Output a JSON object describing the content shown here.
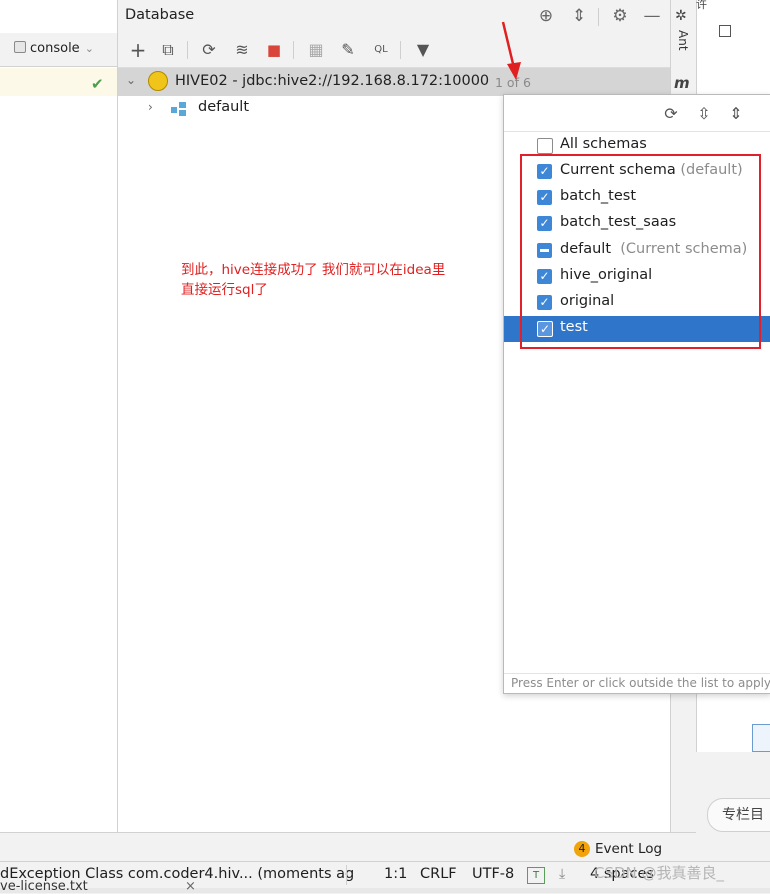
{
  "db_window": {
    "title": "Database",
    "connection": {
      "label": "HIVE02 - jdbc:hive2://192.168.8.172:10000",
      "count": "1 of 6"
    },
    "tree_child": "default"
  },
  "editor": {
    "tab_label": "console"
  },
  "side": {
    "ant_label": "Ant",
    "m_label": "m"
  },
  "popup": {
    "schemas": [
      {
        "label": "All schemas",
        "hint": "",
        "state": "unchecked"
      },
      {
        "label": "Current schema",
        "hint": "(default)",
        "state": "checked"
      },
      {
        "label": "batch_test",
        "hint": "",
        "state": "checked"
      },
      {
        "label": "batch_test_saas",
        "hint": "",
        "state": "checked"
      },
      {
        "label": "default",
        "hint": "(Current schema)",
        "state": "partial"
      },
      {
        "label": "hive_original",
        "hint": "",
        "state": "checked"
      },
      {
        "label": "original",
        "hint": "",
        "state": "checked"
      },
      {
        "label": "test",
        "hint": "",
        "state": "checked",
        "selected": true
      }
    ],
    "footer": "Press Enter or click outside the list to apply"
  },
  "annotation": {
    "line1": "到此，hive连接成功了  我们就可以在idea里",
    "line2": "直接运行sql了"
  },
  "event_log": {
    "badge": "4",
    "label": "Event Log"
  },
  "status_bar": {
    "message": "dException Class com.coder4.hiv... (moments ag",
    "position": "1:1",
    "line_sep": "CRLF",
    "encoding": "UTF-8",
    "indent": "4 spaces"
  },
  "right_panel": {
    "top_char": "许",
    "button": "专栏目"
  },
  "watermark": "CSDN @我真善良_",
  "bottom_tab": "ve-license.txt",
  "colors": {
    "accent": "#2f75c9",
    "checkbox": "#3e87d6",
    "annotation_red": "#e02020"
  }
}
